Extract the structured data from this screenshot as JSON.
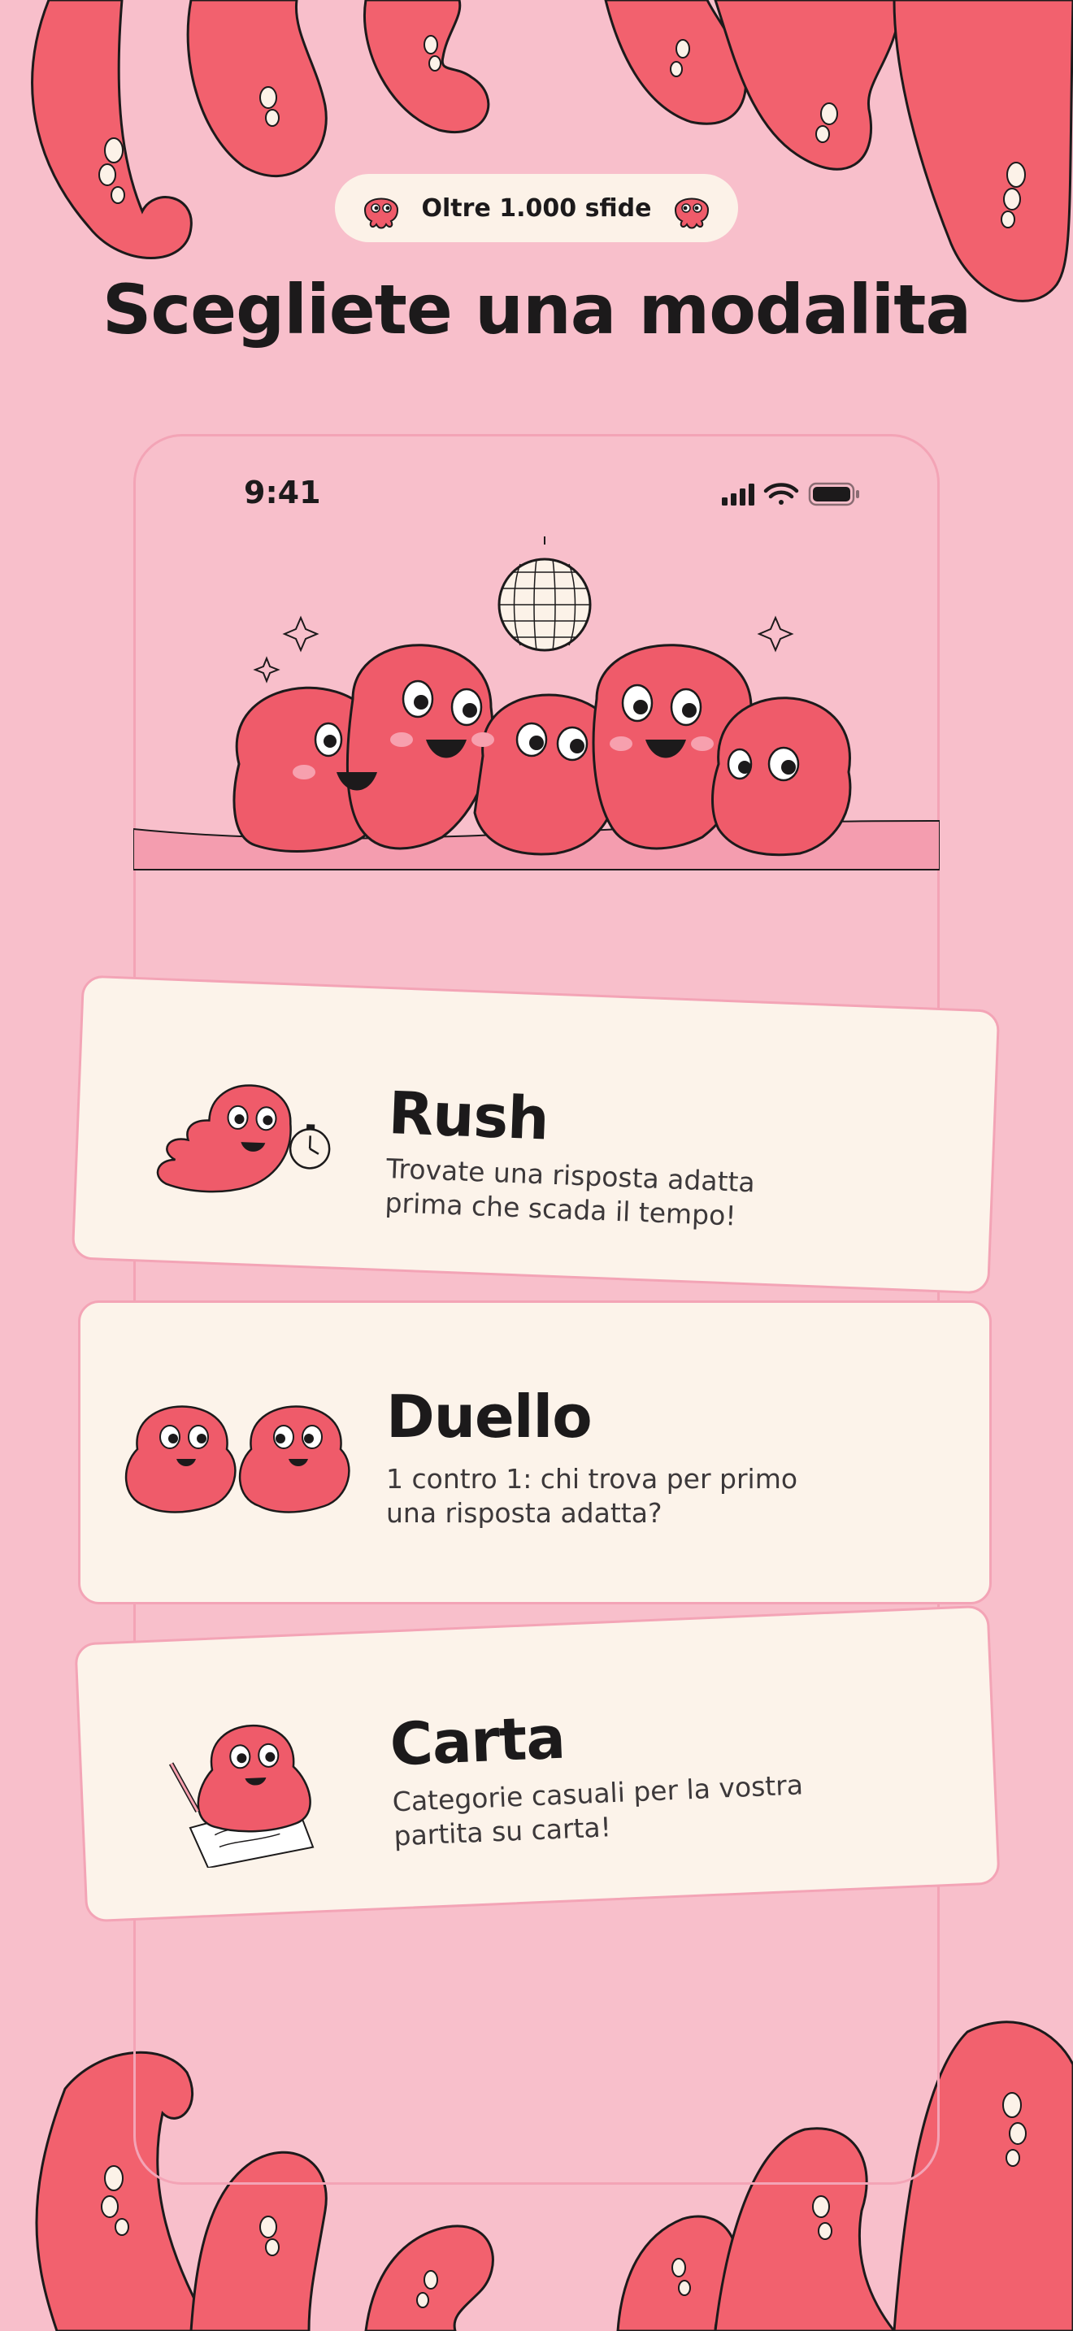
{
  "badge": {
    "label": "Oltre 1.000 sfide"
  },
  "heading": {
    "title": "Scegliete una modalita"
  },
  "status_bar": {
    "time": "9:41"
  },
  "modes": [
    {
      "title": "Rush",
      "description": "Trovate una risposta adatta prima che scada il tempo!"
    },
    {
      "title": "Duello",
      "description": "1 contro 1: chi trova per primo una risposta adatta?"
    },
    {
      "title": "Carta",
      "description": "Categorie casuali per la vostra partita su carta!"
    }
  ],
  "colors": {
    "background": "#F8BFCB",
    "octopus": "#EF5B6A",
    "card": "#FCF3EA",
    "text": "#1C1A1B"
  }
}
